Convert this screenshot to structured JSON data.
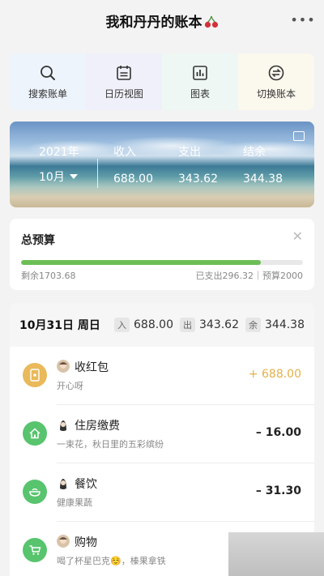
{
  "header": {
    "title": "我和丹丹的账本",
    "more_label": "•••"
  },
  "actions": [
    {
      "label": "搜索账单",
      "icon": "search-icon"
    },
    {
      "label": "日历视图",
      "icon": "calendar-icon"
    },
    {
      "label": "图表",
      "icon": "chart-icon"
    },
    {
      "label": "切换账本",
      "icon": "switch-icon"
    }
  ],
  "summary": {
    "year": "2021年",
    "month": "10月",
    "income_label": "收入",
    "income": "688.00",
    "expense_label": "支出",
    "expense": "343.62",
    "balance_label": "结余",
    "balance": "344.38"
  },
  "budget": {
    "title": "总预算",
    "remaining": "剩余1703.68",
    "spent": "已支出296.32｜预算2000",
    "progress_fraction": 0.852
  },
  "day": {
    "date": "10月31日 周日",
    "in_chip": "入",
    "in": "688.00",
    "out_chip": "出",
    "out": "343.62",
    "bal_chip": "余",
    "bal": "344.38"
  },
  "transactions": [
    {
      "name": "收红包",
      "note": "开心呀",
      "amount": "+ 688.00",
      "type": "income",
      "cat_color": "#e9b95a",
      "icon": "red-envelope-icon"
    },
    {
      "name": "住房缴费",
      "note": "一束花，秋日里的五彩缤纷",
      "amount": "– 16.00",
      "type": "expense",
      "cat_color": "#58c46e",
      "icon": "house-icon"
    },
    {
      "name": "餐饮",
      "note": "健康果蔬",
      "amount": "– 31.30",
      "type": "expense",
      "cat_color": "#58c46e",
      "icon": "bowl-icon"
    },
    {
      "name": "购物",
      "note": "喝了杯星巴克☺️，榛果拿铁",
      "amount": "",
      "type": "expense",
      "cat_color": "#58c46e",
      "icon": "cart-icon"
    }
  ],
  "colors": {
    "accent": "#6cbe55",
    "income": "#e4b04a"
  }
}
